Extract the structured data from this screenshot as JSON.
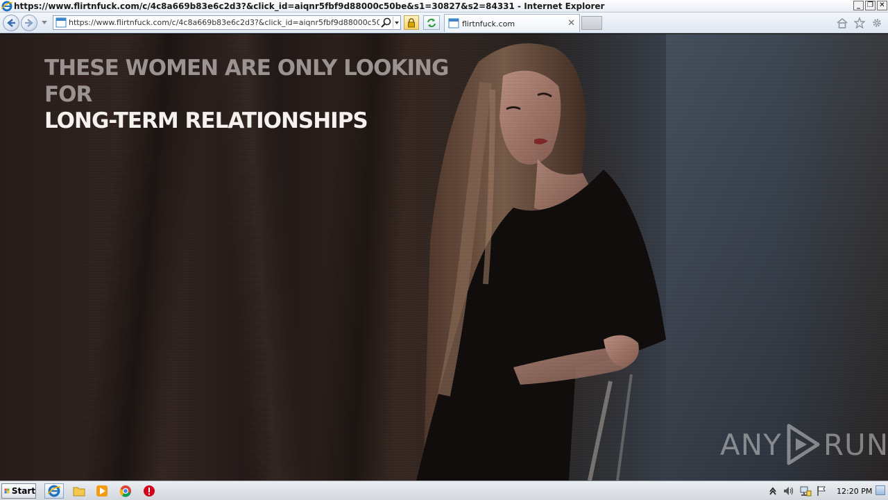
{
  "window": {
    "title": "https://www.flirtnfuck.com/c/4c8a669b83e6c2d3?&click_id=aiqnr5fbf9d88000c50be&s1=30827&s2=84331 - Internet Explorer"
  },
  "address_bar": {
    "url": "https://www.flirtnfuck.com/c/4c8a669b83e6c2d3?&click_id=aiqnr5fbf9d88000c50be&s1=30827&s2=84331"
  },
  "tab": {
    "label": "flirtnfuck.com"
  },
  "page": {
    "headline_line1": "THESE WOMEN ARE ONLY LOOKING",
    "headline_line2": "FOR",
    "headline_line3": "LONG-TERM RELATIONSHIPS"
  },
  "watermark": {
    "left": "ANY",
    "right": "RUN"
  },
  "taskbar": {
    "start_label": "Start",
    "clock": "12:20 PM"
  },
  "colors": {
    "headline_dim": "#9b9391",
    "headline_bright": "#f4f1ee",
    "taskbar_bg": "#dfe3e8",
    "ie_blue": "#1e73be"
  },
  "icons": [
    "ie-logo-icon",
    "back-arrow-icon",
    "forward-arrow-icon",
    "page-icon",
    "search-icon",
    "lock-icon",
    "refresh-icon",
    "home-icon",
    "star-icon",
    "gear-icon",
    "windows-flag-icon",
    "folder-icon",
    "media-player-icon",
    "chrome-icon",
    "stop-icon",
    "tray-arrow-icon",
    "speaker-icon",
    "network-icon",
    "action-center-flag-icon"
  ]
}
